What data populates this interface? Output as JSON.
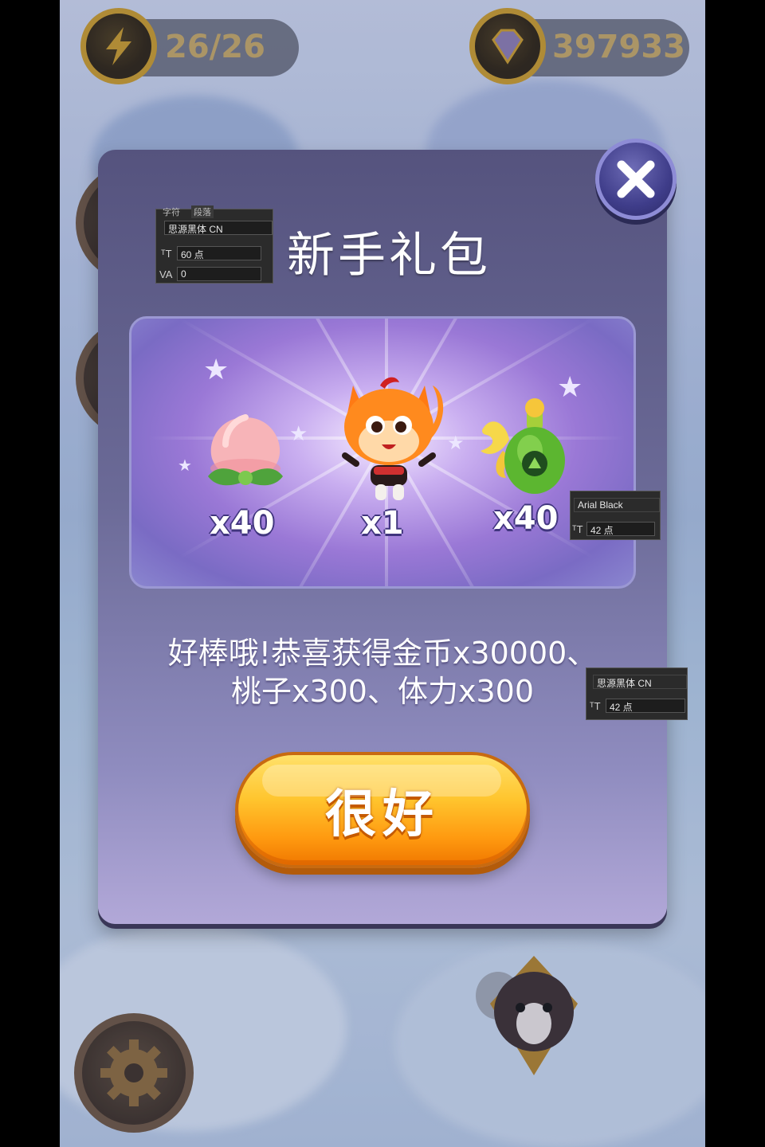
{
  "hud": {
    "energy": "26/26",
    "gems": "397933"
  },
  "popup": {
    "title": "新手礼包",
    "rewards": [
      {
        "icon": "peach-icon",
        "qty": "x40"
      },
      {
        "icon": "fox-mascot-icon",
        "qty": "x1"
      },
      {
        "icon": "green-potion-icon",
        "qty": "x40"
      }
    ],
    "message_line1": "好棒哦!恭喜获得金币x30000、",
    "message_line2": "桃子x300、体力x300",
    "ok_label": "很好"
  },
  "annotations": {
    "title_font": {
      "tab1": "字符",
      "tab2": "段落",
      "font": "思源黑体 CN",
      "size": "60 点",
      "tracking": "0"
    },
    "qty_font": {
      "font": "Arial Black",
      "size": "42 点"
    },
    "message_font": {
      "font": "思源黑体 CN",
      "size": "42 点"
    }
  },
  "colors": {
    "panel": "#6b6a97",
    "button": "#ffb21e",
    "close": "#3f3d8a"
  }
}
